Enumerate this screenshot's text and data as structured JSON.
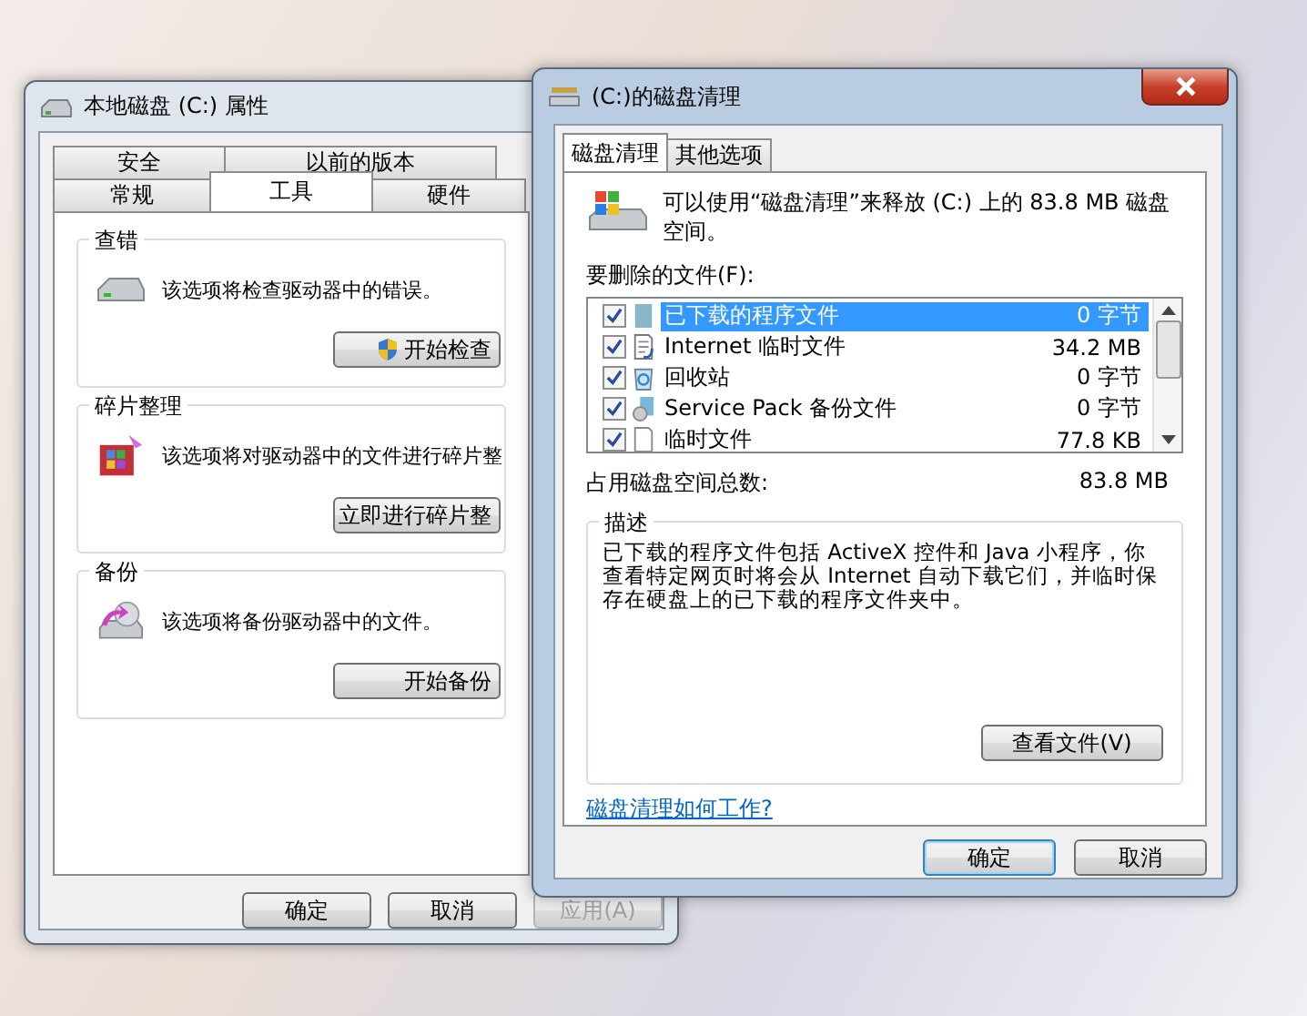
{
  "properties_window": {
    "title": "本地磁盘 (C:) 属性",
    "tabs_back": [
      {
        "label": "安全",
        "selected": false
      },
      {
        "label": "以前的版本",
        "selected": false
      }
    ],
    "tabs_front": [
      {
        "label": "常规",
        "selected": false
      },
      {
        "label": "工具",
        "selected": true
      },
      {
        "label": "硬件",
        "selected": false
      }
    ],
    "groups": [
      {
        "kind": "check",
        "title": "查错",
        "description": "该选项将检查驱动器中的错误。",
        "button": "开始检查"
      },
      {
        "kind": "defrag",
        "title": "碎片整理",
        "description": "该选项将对驱动器中的文件进行碎片整",
        "button": "立即进行碎片整"
      },
      {
        "kind": "backup",
        "title": "备份",
        "description": "该选项将备份驱动器中的文件。",
        "button": "开始备份"
      }
    ],
    "buttons": [
      {
        "label": "确定",
        "disabled": false
      },
      {
        "label": "取消",
        "disabled": false
      },
      {
        "label": "应用(A)",
        "disabled": true
      }
    ]
  },
  "cleanup_window": {
    "title": "(C:)的磁盘清理",
    "tabs": [
      {
        "label": "磁盘清理",
        "selected": true
      },
      {
        "label": "其他选项",
        "selected": false
      }
    ],
    "intro": "可以使用“磁盘清理”来释放  (C:) 上的 83.8 MB 磁盘空间。",
    "files_label": "要删除的文件(F):",
    "files": [
      {
        "kind": "folder",
        "name": "已下载的程序文件",
        "size": "0 字节",
        "checked": true,
        "selected": true
      },
      {
        "kind": "document",
        "name": "Internet 临时文件",
        "size": "34.2 MB",
        "checked": true,
        "selected": false
      },
      {
        "kind": "recycle",
        "name": "回收站",
        "size": "0 字节",
        "checked": true,
        "selected": false
      },
      {
        "kind": "disc",
        "name": "Service Pack 备份文件",
        "size": "0 字节",
        "checked": true,
        "selected": false
      },
      {
        "kind": "page",
        "name": "临时文件",
        "size": "77.8 KB",
        "checked": true,
        "selected": false
      }
    ],
    "total_label": "占用磁盘空间总数:",
    "total": "83.8 MB",
    "description_title": "描述",
    "description": "已下载的程序文件包括 ActiveX 控件和 Java 小程序，你查看特定网页时将会从 Internet 自动下载它们，并临时保存在硬盘上的已下载的程序文件夹中。",
    "view_files_button": "查看文件(V)",
    "help_link": "磁盘清理如何工作?",
    "buttons": [
      {
        "label": "确定",
        "default": true
      },
      {
        "label": "取消",
        "default": false
      }
    ]
  }
}
